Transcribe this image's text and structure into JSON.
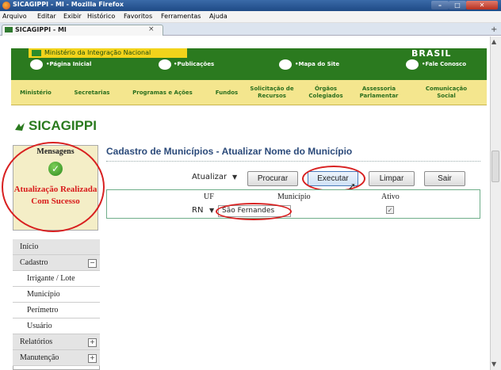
{
  "window": {
    "title": "SICAGIPPI - MI - Mozilla Firefox",
    "min": "–",
    "max": "□",
    "close": "✕"
  },
  "menu": [
    "Arquivo",
    "Editar",
    "Exibir",
    "Histórico",
    "Favoritos",
    "Ferramentas",
    "Ajuda"
  ],
  "tab": {
    "label": "SICAGIPPI - MI",
    "close": "×",
    "new": "+"
  },
  "header": {
    "ministry": "Ministério da Integração Nacional",
    "logo": "BRASIL",
    "nav": [
      "•Página Inicial",
      "•Publicações",
      "•Mapa do Site",
      "•Fale Conosco"
    ]
  },
  "section_nav": [
    "Ministério",
    "Secretarias",
    "Programas e Ações",
    "Fundos",
    "Solicitação de Recursos",
    "Órgãos Colegiados",
    "Assessoria Parlamentar",
    "Comunicação Social"
  ],
  "brand": "SICAGIPPI",
  "messages": {
    "title": "Mensagens",
    "check": "✓",
    "text": "Atualização Realizada Com Sucesso"
  },
  "sidebar": {
    "items": [
      {
        "label": "Início"
      },
      {
        "label": "Cadastro",
        "toggle": "−"
      },
      {
        "label": "Irrigante / Lote"
      },
      {
        "label": "Município"
      },
      {
        "label": "Perímetro"
      },
      {
        "label": "Usuário"
      },
      {
        "label": "Relatórios",
        "toggle": "+"
      },
      {
        "label": "Manutenção",
        "toggle": "+"
      }
    ]
  },
  "form": {
    "title": "Cadastro de Municípios - Atualizar Nome do Município",
    "action_select": "Atualizar",
    "buttons": {
      "procurar": "Procurar",
      "executar": "Executar",
      "limpar": "Limpar",
      "sair": "Sair"
    },
    "columns": {
      "uf": "UF",
      "municipio": "Município",
      "ativo": "Ativo"
    },
    "row": {
      "uf": "RN",
      "municipio": "São Fernandes",
      "ativo_check": "✓"
    }
  },
  "colors": {
    "green": "#2b7a1f",
    "yellow": "#f4e68e",
    "alert_red": "#d81b1b"
  }
}
